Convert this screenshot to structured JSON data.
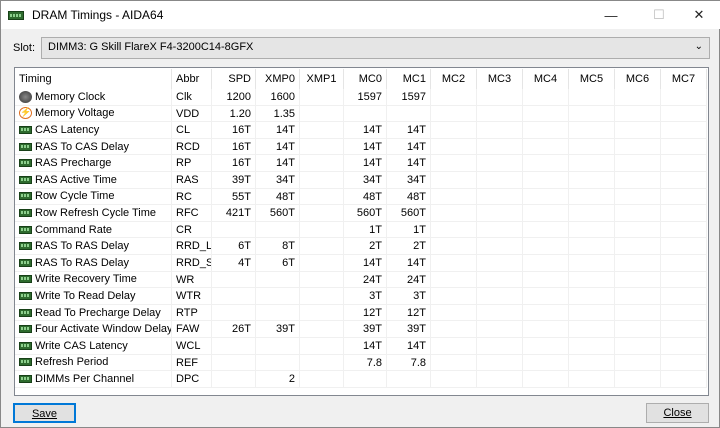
{
  "window": {
    "title": "DRAM Timings - AIDA64",
    "minimize": "—",
    "maximize": "☐",
    "close": "✕"
  },
  "slot": {
    "label": "Slot:",
    "value": "DIMM3: G Skill FlareX F4-3200C14-8GFX"
  },
  "columns": [
    "Timing",
    "Abbr",
    "SPD",
    "XMP0",
    "XMP1",
    "MC0",
    "MC1",
    "MC2",
    "MC3",
    "MC4",
    "MC5",
    "MC6",
    "MC7"
  ],
  "rows": [
    {
      "icon": "clock",
      "name": "Memory Clock",
      "abbr": "Clk",
      "spd": "1200",
      "xmp0": "1600",
      "xmp1": "",
      "mc0": "1597",
      "mc1": "1597"
    },
    {
      "icon": "volt",
      "name": "Memory Voltage",
      "abbr": "VDD",
      "spd": "1.20",
      "xmp0": "1.35",
      "xmp1": "",
      "mc0": "",
      "mc1": ""
    },
    {
      "icon": "ram",
      "name": "CAS Latency",
      "abbr": "CL",
      "spd": "16T",
      "xmp0": "14T",
      "xmp1": "",
      "mc0": "14T",
      "mc1": "14T"
    },
    {
      "icon": "ram",
      "name": "RAS To CAS Delay",
      "abbr": "RCD",
      "spd": "16T",
      "xmp0": "14T",
      "xmp1": "",
      "mc0": "14T",
      "mc1": "14T"
    },
    {
      "icon": "ram",
      "name": "RAS Precharge",
      "abbr": "RP",
      "spd": "16T",
      "xmp0": "14T",
      "xmp1": "",
      "mc0": "14T",
      "mc1": "14T"
    },
    {
      "icon": "ram",
      "name": "RAS Active Time",
      "abbr": "RAS",
      "spd": "39T",
      "xmp0": "34T",
      "xmp1": "",
      "mc0": "34T",
      "mc1": "34T"
    },
    {
      "icon": "ram",
      "name": "Row Cycle Time",
      "abbr": "RC",
      "spd": "55T",
      "xmp0": "48T",
      "xmp1": "",
      "mc0": "48T",
      "mc1": "48T"
    },
    {
      "icon": "ram",
      "name": "Row Refresh Cycle Time",
      "abbr": "RFC",
      "spd": "421T",
      "xmp0": "560T",
      "xmp1": "",
      "mc0": "560T",
      "mc1": "560T"
    },
    {
      "icon": "ram",
      "name": "Command Rate",
      "abbr": "CR",
      "spd": "",
      "xmp0": "",
      "xmp1": "",
      "mc0": "1T",
      "mc1": "1T"
    },
    {
      "icon": "ram",
      "name": "RAS To RAS Delay",
      "abbr": "RRD_L",
      "spd": "6T",
      "xmp0": "8T",
      "xmp1": "",
      "mc0": "2T",
      "mc1": "2T"
    },
    {
      "icon": "ram",
      "name": "RAS To RAS Delay",
      "abbr": "RRD_S",
      "spd": "4T",
      "xmp0": "6T",
      "xmp1": "",
      "mc0": "14T",
      "mc1": "14T"
    },
    {
      "icon": "ram",
      "name": "Write Recovery Time",
      "abbr": "WR",
      "spd": "",
      "xmp0": "",
      "xmp1": "",
      "mc0": "24T",
      "mc1": "24T"
    },
    {
      "icon": "ram",
      "name": "Write To Read Delay",
      "abbr": "WTR",
      "spd": "",
      "xmp0": "",
      "xmp1": "",
      "mc0": "3T",
      "mc1": "3T"
    },
    {
      "icon": "ram",
      "name": "Read To Precharge Delay",
      "abbr": "RTP",
      "spd": "",
      "xmp0": "",
      "xmp1": "",
      "mc0": "12T",
      "mc1": "12T"
    },
    {
      "icon": "ram",
      "name": "Four Activate Window Delay",
      "abbr": "FAW",
      "spd": "26T",
      "xmp0": "39T",
      "xmp1": "",
      "mc0": "39T",
      "mc1": "39T"
    },
    {
      "icon": "ram",
      "name": "Write CAS Latency",
      "abbr": "WCL",
      "spd": "",
      "xmp0": "",
      "xmp1": "",
      "mc0": "14T",
      "mc1": "14T"
    },
    {
      "icon": "ram",
      "name": "Refresh Period",
      "abbr": "REF",
      "spd": "",
      "xmp0": "",
      "xmp1": "",
      "mc0": "7.8",
      "mc1": "7.8"
    },
    {
      "icon": "ram",
      "name": "DIMMs Per Channel",
      "abbr": "DPC",
      "spd": "",
      "xmp0": "2",
      "xmp1": "",
      "mc0": "",
      "mc1": ""
    }
  ],
  "buttons": {
    "save": "Save",
    "close": "Close"
  }
}
